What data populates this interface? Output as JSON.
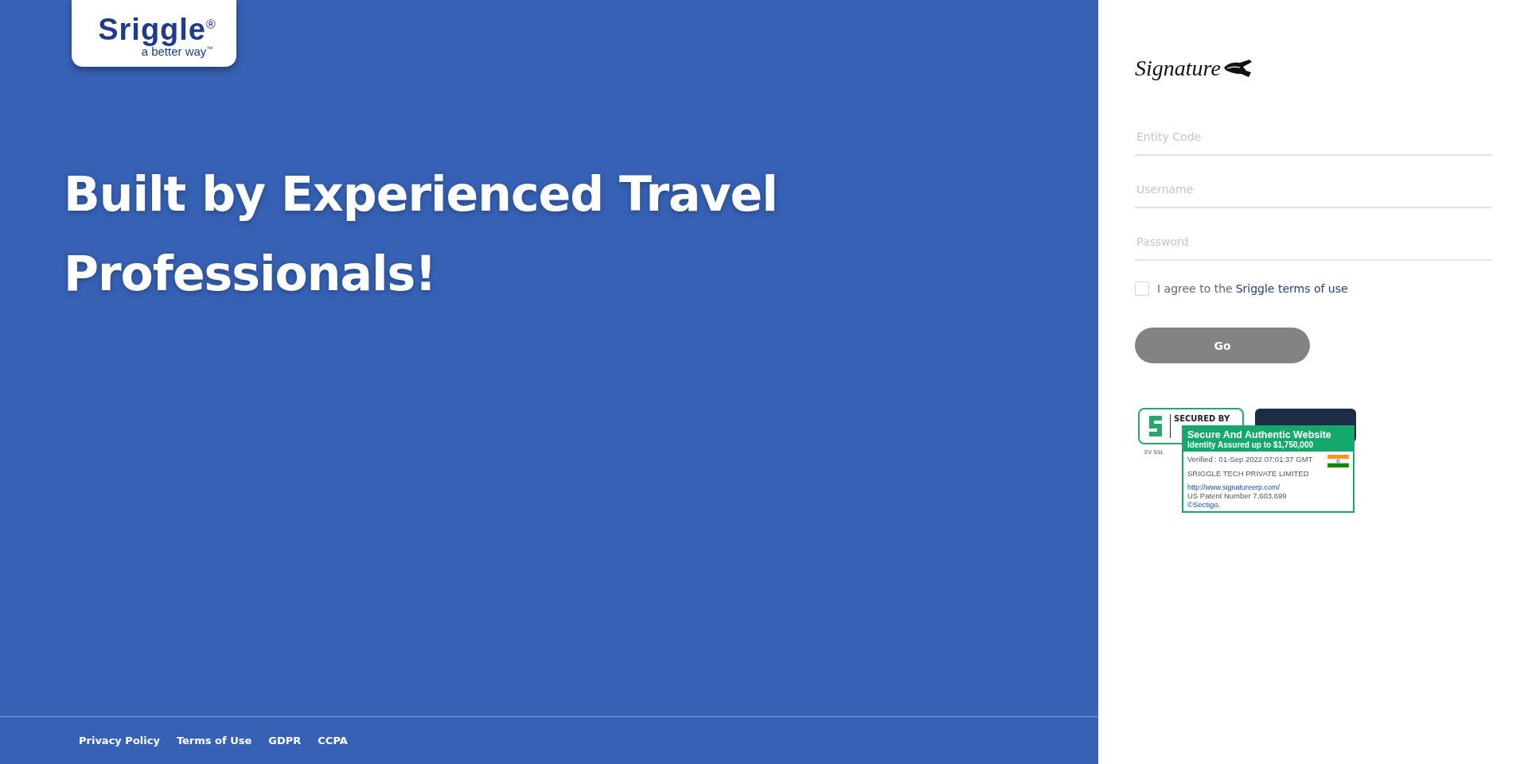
{
  "brand": {
    "name": "Sriggle$^{®}$",
    "tagline": "a better way$^{™}$"
  },
  "headline": "Built by Experienced Travel Professionals!",
  "footer_links": [
    "Privacy Policy",
    "Terms of Use",
    "GDPR",
    "CCPA"
  ],
  "product_logo": "Signature",
  "login_form": {
    "fields": [
      {
        "placeholder": "Entity Code"
      },
      {
        "placeholder": "Username"
      },
      {
        "placeholder": "Password"
      }
    ],
    "agreement": {
      "text": "I agree to the",
      "link": "Sriggle terms of use",
      "checked": false
    },
    "submit": {
      "label": "Go",
      "disabled": true
    }
  },
  "security_seal": {
    "badge_text": "SECURED BY",
    "badge_caption": "EV SSL",
    "popup": {
      "title": "Secure And Authentic Website",
      "subtitle": "Identity Assured up to $1,750,000",
      "verified": "Verified : 01-Sep 2022 07:01:37 GMT",
      "company": "SRIGGLE TECH PRIVATE LIMITED",
      "url": "http://www.signatureerp.com/",
      "patent": "US Patent Number 7,603,699",
      "issuer": "©Sectigo."
    }
  }
}
